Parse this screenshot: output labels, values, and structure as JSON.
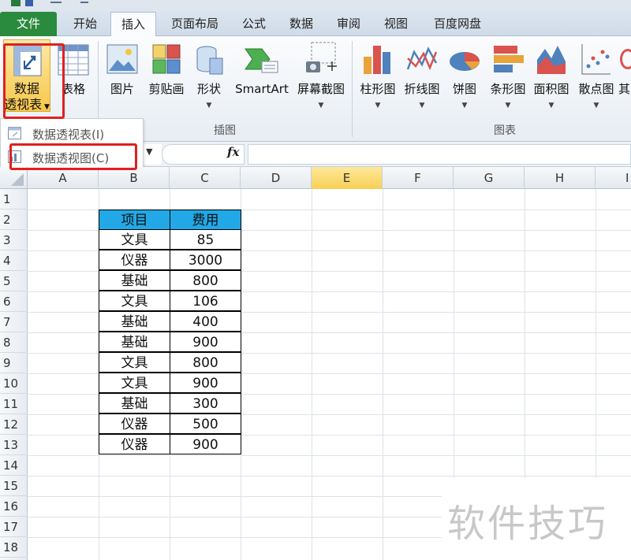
{
  "ribbon_tabs": [
    "文件",
    "开始",
    "插入",
    "页面布局",
    "公式",
    "数据",
    "审阅",
    "视图",
    "百度网盘"
  ],
  "ribbon": {
    "pivot_table_label": [
      "数据",
      "透视表"
    ],
    "table_label": "表格",
    "picture_label": "图片",
    "clipart_label": "剪贴画",
    "shapes_label": "形状",
    "smartart_label": "SmartArt",
    "screenshot_label": "屏幕截图",
    "column_chart_label": "柱形图",
    "line_chart_label": "折线图",
    "pie_chart_label": "饼图",
    "bar_chart_label": "条形图",
    "area_chart_label": "面积图",
    "scatter_chart_label": "散点图",
    "other_chart_label": "其",
    "illustrations_group": "插图",
    "charts_group": "图表"
  },
  "dropdown": {
    "items": [
      "数据透视表(I)",
      "数据透视图(C)"
    ]
  },
  "formula_bar": {
    "fx_label": "fx",
    "name_box_arrow": "▼"
  },
  "sheet": {
    "columns": [
      "A",
      "B",
      "C",
      "D",
      "E",
      "F",
      "G",
      "H",
      "I"
    ],
    "rows": [
      "1",
      "2",
      "3",
      "4",
      "5",
      "6",
      "7",
      "8",
      "9",
      "10",
      "11",
      "12",
      "13",
      "14",
      "15",
      "16",
      "17",
      "18"
    ],
    "selected_column": "E",
    "header_fill_color": "#22a8e6",
    "table_header": [
      "项目",
      "费用"
    ],
    "table_rows": [
      [
        "文具",
        "85"
      ],
      [
        "仪器",
        "3000"
      ],
      [
        "基础",
        "800"
      ],
      [
        "文具",
        "106"
      ],
      [
        "基础",
        "400"
      ],
      [
        "基础",
        "900"
      ],
      [
        "文具",
        "800"
      ],
      [
        "文具",
        "900"
      ],
      [
        "基础",
        "300"
      ],
      [
        "仪器",
        "500"
      ],
      [
        "仪器",
        "900"
      ]
    ]
  },
  "watermark": "软件技巧",
  "highlight_color": "#e02020",
  "active_tab": "插入"
}
